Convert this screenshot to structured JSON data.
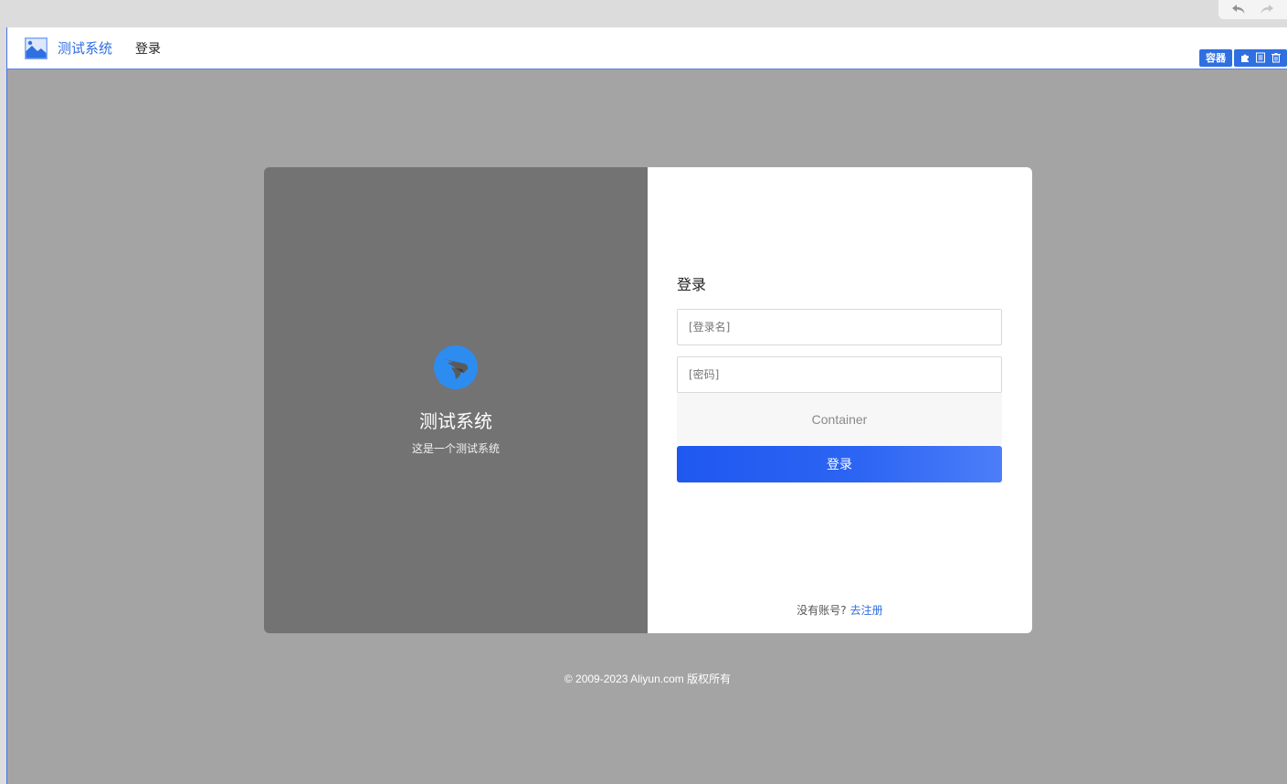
{
  "app": {
    "title": "测试系统",
    "nav_login": "登录"
  },
  "editor": {
    "chip_label": "容器"
  },
  "card": {
    "title": "测试系统",
    "subtitle": "这是一个测试系统",
    "form": {
      "heading": "登录",
      "username_placeholder": "[登录名]",
      "password_placeholder": "[密码]",
      "container_placeholder": "Container",
      "submit_label": "登录",
      "register_prompt": "没有账号?",
      "register_link": "去注册"
    }
  },
  "footer": {
    "copyright": "© 2009-2023 Aliyun.com 版权所有"
  },
  "colors": {
    "accent": "#2f6fe0",
    "canvas_bg": "#a4a4a4",
    "card_left_bg": "#737373",
    "logo_circle": "#2d8cf0"
  },
  "icons": {
    "undo": "undo-icon",
    "redo": "redo-icon",
    "brand": "image-logo-icon",
    "card_logo": "bird-logo-icon",
    "move": "puzzle-icon",
    "properties": "list-icon",
    "delete": "trash-icon"
  }
}
